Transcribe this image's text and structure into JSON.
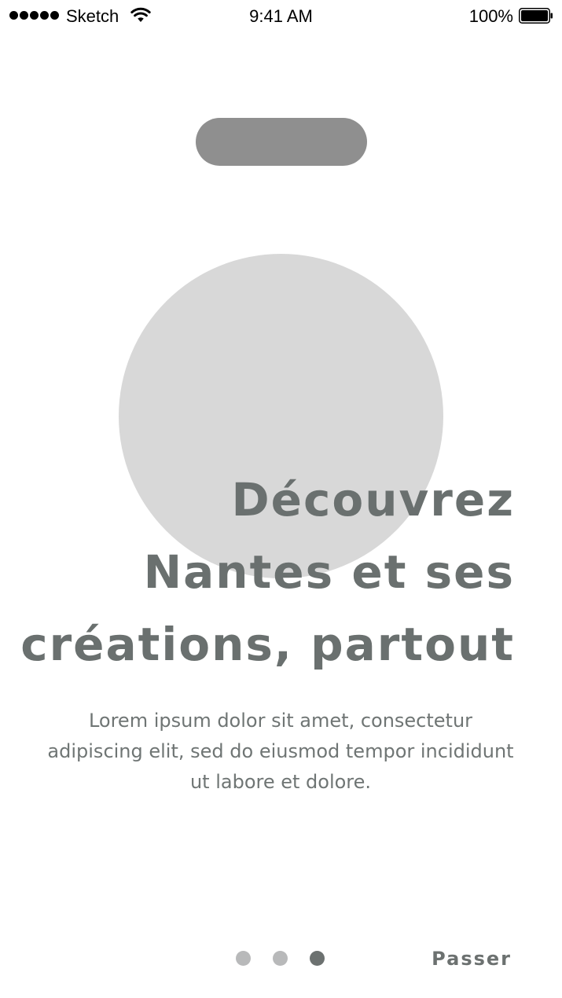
{
  "status_bar": {
    "carrier": "Sketch",
    "time": "9:41 AM",
    "battery_percent": "100%",
    "signal_bars": 5,
    "battery_level": 1.0,
    "icons": [
      "signal-dots-icon",
      "wifi-icon",
      "battery-icon"
    ]
  },
  "hero": {
    "headline_lines": [
      "Découvrez",
      "Nantes et ses",
      "créations, partout"
    ],
    "description": "Lorem ipsum dolor sit amet, consectetur adipiscing elit, sed do eiusmod tempor incididunt ut labore et dolore."
  },
  "pager": {
    "total": 3,
    "current": 3
  },
  "skip_label": "Passer",
  "colors": {
    "text": "#6a706f",
    "pill": "#8f8f8f",
    "circle": "#d8d8d8",
    "dot_inactive": "#b8b9ba",
    "dot_active": "#6c7170"
  }
}
